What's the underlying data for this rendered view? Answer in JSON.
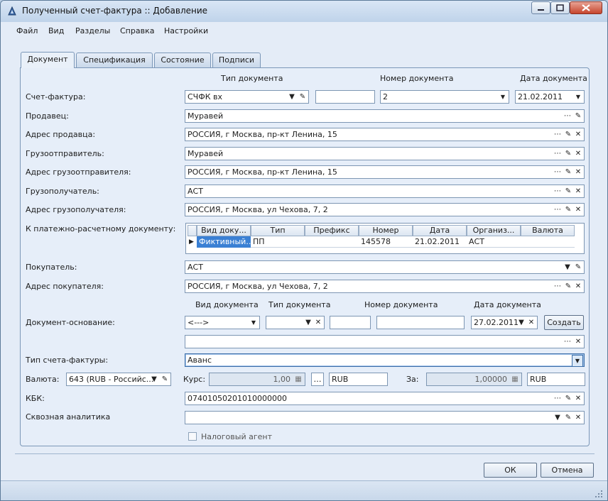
{
  "window": {
    "title": "Полученный счет-фактура :: Добавление"
  },
  "menu": [
    "Файл",
    "Вид",
    "Разделы",
    "Справка",
    "Настройки"
  ],
  "tabs": [
    "Документ",
    "Спецификация",
    "Состояние",
    "Подписи"
  ],
  "headers": {
    "doc_type": "Тип документа",
    "doc_number": "Номер документа",
    "doc_date": "Дата документа"
  },
  "invoice": {
    "label": "Счет-фактура:",
    "type": "СЧФК вх",
    "prefix": "",
    "number": "2",
    "date": "21.02.2011"
  },
  "seller": {
    "label": "Продавец:",
    "value": "Муравей"
  },
  "seller_address": {
    "label": "Адрес продавца:",
    "value": "РОССИЯ, г Москва, пр-кт Ленина, 15"
  },
  "shipper": {
    "label": "Грузоотправитель:",
    "value": "Муравей"
  },
  "shipper_address": {
    "label": "Адрес грузоотправителя:",
    "value": "РОССИЯ, г Москва, пр-кт Ленина, 15"
  },
  "consignee": {
    "label": "Грузополучатель:",
    "value": "АСТ"
  },
  "consignee_address": {
    "label": "Адрес грузополучателя:",
    "value": "РОССИЯ, г Москва, ул Чехова, 7, 2"
  },
  "payment_doc": {
    "label": "К платежно-расчетному документу:",
    "columns": [
      "Вид доку...",
      "Тип",
      "Префикс",
      "Номер",
      "Дата",
      "Организ...",
      "Валюта"
    ],
    "rows": [
      [
        "Фиктивный...",
        "ПП",
        "",
        "145578",
        "21.02.2011",
        "АСТ",
        ""
      ]
    ]
  },
  "buyer": {
    "label": "Покупатель:",
    "value": "АСТ"
  },
  "buyer_address": {
    "label": "Адрес покупателя:",
    "value": "РОССИЯ, г Москва, ул Чехова, 7, 2"
  },
  "basis": {
    "label": "Документ-основание:",
    "headers": {
      "kind": "Вид документа",
      "type": "Тип документа",
      "number": "Номер документа",
      "date": "Дата документа"
    },
    "kind": "<--->",
    "type": "",
    "prefix": "",
    "number": "",
    "date": "27.02.2011",
    "create_label": "Создать",
    "extra": ""
  },
  "invoice_type": {
    "label": "Тип счета-фактуры:",
    "value": "Аванс"
  },
  "currency": {
    "label": "Валюта:",
    "value": "643 (RUB - Российс...",
    "rate_label": "Курс:",
    "rate": "1,00",
    "rate_cur": "RUB",
    "per_label": "За:",
    "per": "1,00000",
    "per_cur": "RUB"
  },
  "kbk": {
    "label": "КБК:",
    "value": "07401050201010000000"
  },
  "analytics": {
    "label": "Сквозная аналитика",
    "value": ""
  },
  "tax_agent": {
    "label": "Налоговый агент",
    "checked": false
  },
  "buttons": {
    "ok": "ОК",
    "cancel": "Отмена"
  }
}
